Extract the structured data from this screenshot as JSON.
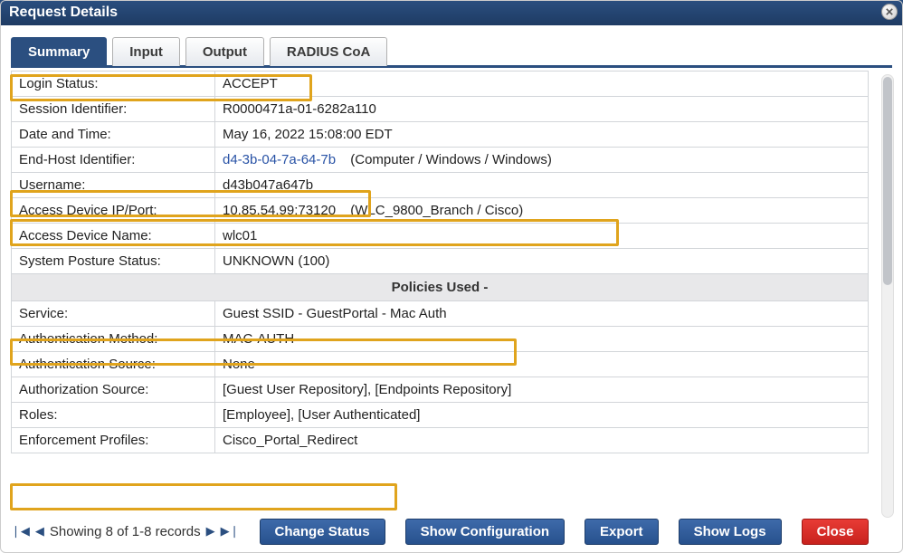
{
  "title": "Request Details",
  "tabs": {
    "t1": "Summary",
    "t2": "Input",
    "t3": "Output",
    "t4": "RADIUS CoA"
  },
  "rows": {
    "login_status": {
      "label": "Login Status:",
      "value": "ACCEPT"
    },
    "session_id": {
      "label": "Session Identifier:",
      "value": "R0000471a-01-6282a110"
    },
    "datetime": {
      "label": "Date and Time:",
      "value": "May 16, 2022 15:08:00 EDT"
    },
    "endhost": {
      "label": "End-Host Identifier:",
      "mac": "d4-3b-04-7a-64-7b",
      "descr": "(Computer / Windows / Windows)"
    },
    "username": {
      "label": "Username:",
      "value": "d43b047a647b"
    },
    "access_ip": {
      "label": "Access Device IP/Port:",
      "value": "10.85.54.99:73120",
      "descr": "(WLC_9800_Branch / Cisco)"
    },
    "access_name": {
      "label": "Access Device Name:",
      "value": "wlc01"
    },
    "posture": {
      "label": "System Posture Status:",
      "value": "UNKNOWN (100)"
    }
  },
  "section_header": "Policies Used -",
  "policies": {
    "service": {
      "label": "Service:",
      "value": "Guest SSID - GuestPortal - Mac Auth"
    },
    "auth_method": {
      "label": "Authentication Method:",
      "value": "MAC-AUTH"
    },
    "auth_source": {
      "label": "Authentication Source:",
      "value": "None"
    },
    "authz_source": {
      "label": "Authorization Source:",
      "value": "[Guest User Repository], [Endpoints Repository]"
    },
    "roles": {
      "label": "Roles:",
      "value": "[Employee], [User Authenticated]"
    },
    "enf": {
      "label": "Enforcement Profiles:",
      "value": "Cisco_Portal_Redirect"
    }
  },
  "pager": "Showing 8 of 1-8 records",
  "buttons": {
    "change": "Change Status",
    "show_cfg": "Show Configuration",
    "export": "Export",
    "show_logs": "Show Logs",
    "close": "Close"
  }
}
